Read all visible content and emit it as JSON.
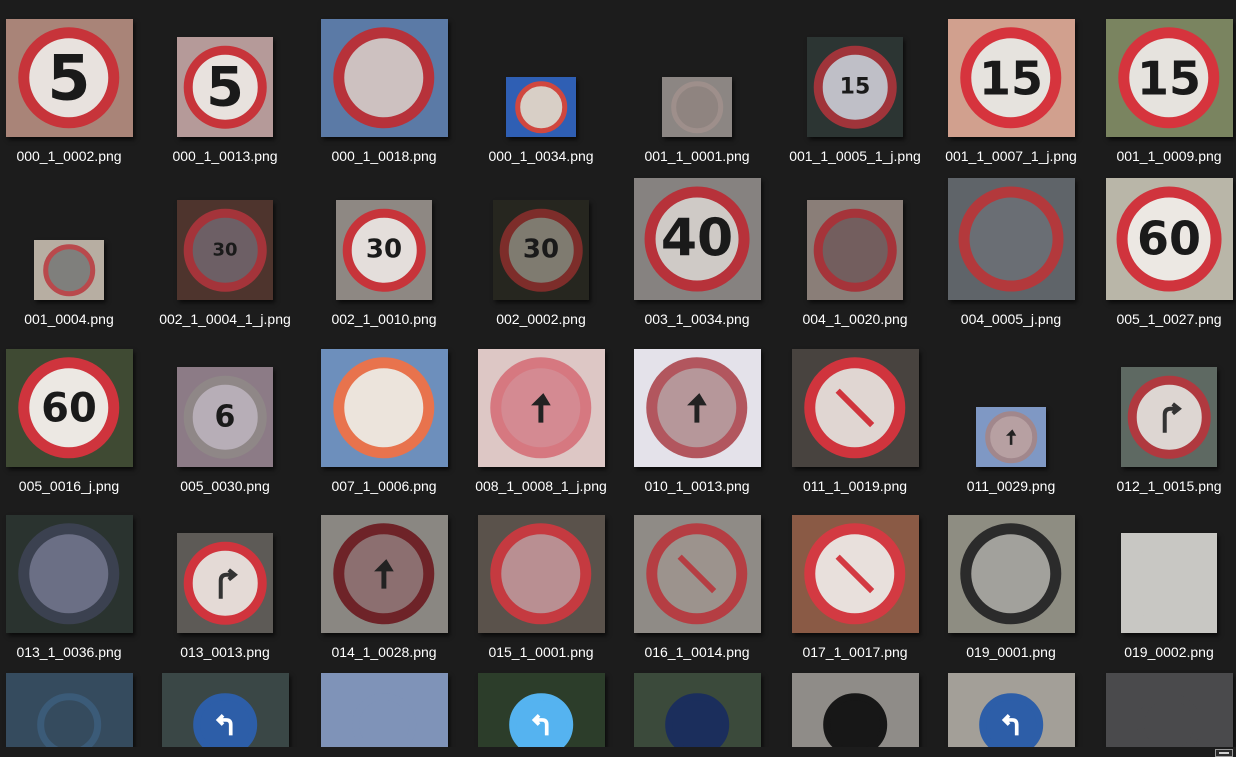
{
  "files": [
    {
      "name": "000_1_0002.png",
      "bg": "#a98478",
      "ring": "#c7343a",
      "inner": "#e8e2de",
      "text": "5",
      "font": 62,
      "size": "l"
    },
    {
      "name": "000_1_0013.png",
      "bg": "#b59a99",
      "ring": "#c7343a",
      "inner": "#e8e2de",
      "text": "5",
      "font": 54,
      "size": "m"
    },
    {
      "name": "000_1_0018.png",
      "bg": "#5b7aa6",
      "ring": "#b7323a",
      "inner": "#cdc1c0",
      "text": "",
      "font": 0,
      "size": "l"
    },
    {
      "name": "000_1_0034.png",
      "bg": "#2f5fb4",
      "ring": "#d0473f",
      "inner": "#d8cfc6",
      "text": "",
      "font": 0,
      "size": "s"
    },
    {
      "name": "001_1_0001.png",
      "bg": "#8c8683",
      "ring": "#9e8f8b",
      "inner": "#8f8480",
      "text": "",
      "font": 0,
      "size": "s"
    },
    {
      "name": "001_1_0005_1_j.png",
      "bg": "#2c3533",
      "ring": "#a0343a",
      "inner": "#bfbfc7",
      "text": "15",
      "font": 22,
      "size": "m"
    },
    {
      "name": "001_1_0007_1_j.png",
      "bg": "#d1a08e",
      "ring": "#d6343d",
      "inner": "#e6e3de",
      "text": "15",
      "font": 46,
      "size": "l"
    },
    {
      "name": "001_1_0009.png",
      "bg": "#7a8460",
      "ring": "#d6343d",
      "inner": "#e6e3de",
      "text": "15",
      "font": 46,
      "size": "l"
    },
    {
      "name": "001_0004.png",
      "bg": "#b7aea2",
      "ring": "#b9494c",
      "inner": "#7f7f7c",
      "text": "",
      "font": 0,
      "size": "s"
    },
    {
      "name": "002_1_0004_1_j.png",
      "bg": "#4e342d",
      "ring": "#a4343a",
      "inner": "#6d5f65",
      "text": "30",
      "font": 18,
      "size": "m"
    },
    {
      "name": "002_1_0010.png",
      "bg": "#8e8883",
      "ring": "#c7343a",
      "inner": "#e4dedb",
      "text": "30",
      "font": 26,
      "size": "m"
    },
    {
      "name": "002_0002.png",
      "bg": "#26261f",
      "ring": "#7d2d2a",
      "inner": "#7f7b70",
      "text": "30",
      "font": 26,
      "size": "m"
    },
    {
      "name": "003_1_0034.png",
      "bg": "#868280",
      "ring": "#b7323a",
      "inner": "#cfcac6",
      "text": "40",
      "font": 52,
      "size": "l"
    },
    {
      "name": "004_1_0020.png",
      "bg": "#8a7e78",
      "ring": "#a5343a",
      "inner": "#735e5e",
      "text": "",
      "font": 0,
      "size": "m"
    },
    {
      "name": "004_0005_j.png",
      "bg": "#5f6469",
      "ring": "#b3393c",
      "inner": "#6a6e74",
      "text": "",
      "font": 0,
      "size": "l"
    },
    {
      "name": "005_1_0027.png",
      "bg": "#b9b6a8",
      "ring": "#d0343d",
      "inner": "#ece8e3",
      "text": "60",
      "font": 46,
      "size": "l"
    },
    {
      "name": "005_0016_j.png",
      "bg": "#3f4a33",
      "ring": "#cf343d",
      "inner": "#ece8e3",
      "text": "60",
      "font": 40,
      "size": "l"
    },
    {
      "name": "005_0030.png",
      "bg": "#8c7b86",
      "ring": "#8f8787",
      "inner": "#b7aeb7",
      "text": "6",
      "font": 30,
      "size": "m"
    },
    {
      "name": "007_1_0006.png",
      "bg": "#6d8fbc",
      "ring": "#e8734d",
      "inner": "#ece4dc",
      "text": "",
      "font": 0,
      "size": "l"
    },
    {
      "name": "008_1_0008_1_j.png",
      "bg": "#ddc7c5",
      "ring": "#d67880",
      "inner": "#d48a92",
      "text": "",
      "font": 0,
      "size": "l",
      "mark": "arrow"
    },
    {
      "name": "010_1_0013.png",
      "bg": "#e4e2ea",
      "ring": "#b2565e",
      "inner": "#b6979a",
      "text": "",
      "font": 0,
      "size": "l",
      "mark": "arrow"
    },
    {
      "name": "011_1_0019.png",
      "bg": "#48433f",
      "ring": "#d0343d",
      "inner": "#e0d6d2",
      "text": "",
      "font": 0,
      "size": "l",
      "mark": "slash"
    },
    {
      "name": "011_0029.png",
      "bg": "#7f98c4",
      "ring": "#a1878c",
      "inner": "#b7a0a2",
      "text": "",
      "font": 0,
      "size": "s",
      "mark": "arrow"
    },
    {
      "name": "012_1_0015.png",
      "bg": "#5e6962",
      "ring": "#b0393f",
      "inner": "#ddd6d2",
      "text": "",
      "font": 0,
      "size": "m",
      "mark": "turn"
    },
    {
      "name": "013_1_0036.png",
      "bg": "#2a332f",
      "ring": "#3b4150",
      "inner": "#6b6f85",
      "text": "",
      "font": 0,
      "size": "l"
    },
    {
      "name": "013_0013.png",
      "bg": "#5d5a56",
      "ring": "#d0343d",
      "inner": "#e4dad6",
      "text": "",
      "font": 0,
      "size": "m",
      "mark": "turn"
    },
    {
      "name": "014_1_0028.png",
      "bg": "#8a8782",
      "ring": "#6e2328",
      "inner": "#8c6f70",
      "text": "",
      "font": 0,
      "size": "l",
      "mark": "arrow"
    },
    {
      "name": "015_1_0001.png",
      "bg": "#5a524b",
      "ring": "#c53a40",
      "inner": "#b98f92",
      "text": "",
      "font": 0,
      "size": "l"
    },
    {
      "name": "016_1_0014.png",
      "bg": "#8f8b86",
      "ring": "#b53e43",
      "inner": "#9c938d",
      "text": "",
      "font": 0,
      "size": "l",
      "mark": "slash"
    },
    {
      "name": "017_1_0017.png",
      "bg": "#8a5a45",
      "ring": "#d33a42",
      "inner": "#e8e0dc",
      "text": "",
      "font": 0,
      "size": "l",
      "mark": "slash"
    },
    {
      "name": "019_0001.png",
      "bg": "#8e8d82",
      "ring": "#2b2b2b",
      "inner": "#a2a19c",
      "text": "",
      "font": 0,
      "size": "l"
    },
    {
      "name": "019_0002.png",
      "bg": "#c8c7c3",
      "ring": "#c8c7c3",
      "inner": "#c8c7c3",
      "text": "",
      "font": 0,
      "size": "m"
    },
    {
      "name": "",
      "bg": "#354b5e",
      "ring": "#3b5b78",
      "inner": "#354b5e",
      "text": "",
      "font": 0,
      "size": "row5"
    },
    {
      "name": "",
      "bg": "#3a4746",
      "ring": "#2d5ea8",
      "inner": "#2d5ea8",
      "text": "",
      "font": 0,
      "size": "row5",
      "mark": "arrow-w"
    },
    {
      "name": "",
      "bg": "#7f93b8",
      "ring": "#7f93b8",
      "inner": "#7f93b8",
      "text": "",
      "font": 0,
      "size": "row5"
    },
    {
      "name": "",
      "bg": "#2c3d2a",
      "ring": "#55b3f0",
      "inner": "#55b3f0",
      "text": "",
      "font": 0,
      "size": "row5",
      "mark": "arrow-w"
    },
    {
      "name": "",
      "bg": "#3b4a3b",
      "ring": "#1b2e5c",
      "inner": "#1b2e5c",
      "text": "",
      "font": 0,
      "size": "row5"
    },
    {
      "name": "",
      "bg": "#8f8c88",
      "ring": "#171717",
      "inner": "#171717",
      "text": "",
      "font": 0,
      "size": "row5"
    },
    {
      "name": "",
      "bg": "#a39f98",
      "ring": "#2d5ea8",
      "inner": "#2d5ea8",
      "text": "",
      "font": 0,
      "size": "row5",
      "mark": "arrow-w"
    },
    {
      "name": "",
      "bg": "#4a4a4c",
      "ring": "#4a4a4c",
      "inner": "#4a4a4c",
      "text": "",
      "font": 0,
      "size": "row5"
    }
  ]
}
